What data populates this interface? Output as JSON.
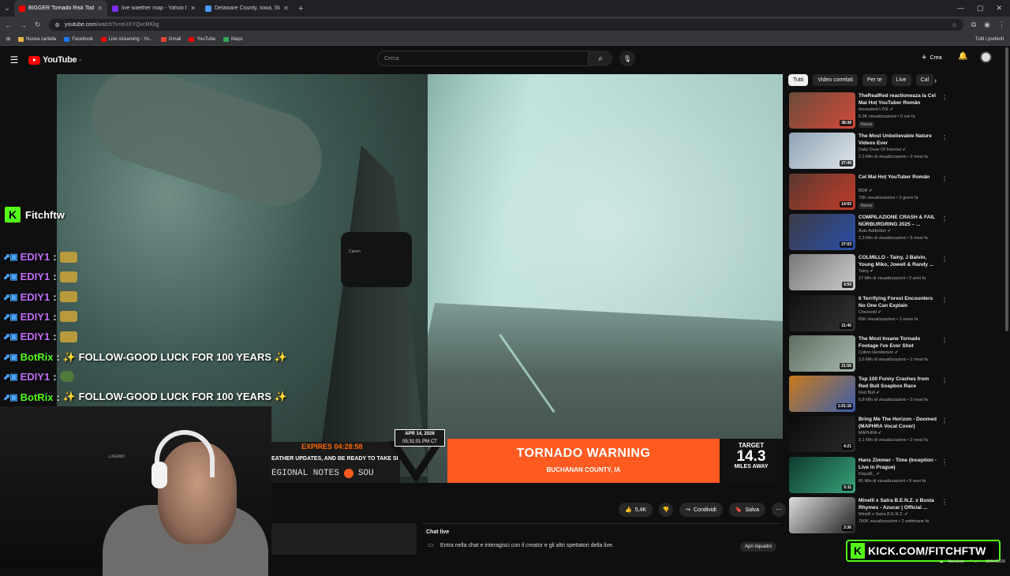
{
  "browser": {
    "tabs": [
      {
        "title": "BIGGER Tornado Risk Today",
        "color": "#ff0000",
        "active": true
      },
      {
        "title": "live waether map - Yahoo Italia",
        "color": "#7b2ff7",
        "active": false
      },
      {
        "title": "Delaware County, Iowa, Stati U...",
        "color": "#4a9bff",
        "active": false
      }
    ],
    "url_host": "youtube.com",
    "url_path": "/watch?v=eUXYQvcRKkg",
    "bookmarks": [
      {
        "label": "Nuova cartella",
        "color": "#e8b64a"
      },
      {
        "label": "Facebook",
        "color": "#1877f2"
      },
      {
        "label": "Live streaming - Yo...",
        "color": "#ff0000"
      },
      {
        "label": "Gmail",
        "color": "#ea4335"
      },
      {
        "label": "YouTube",
        "color": "#ff0000"
      },
      {
        "label": "Maps",
        "color": "#34a853"
      }
    ],
    "bookmarks_right": "Tutti i preferiti"
  },
  "youtube": {
    "logo": "YouTube",
    "logo_sup": "IT",
    "search_placeholder": "Cerca",
    "create_label": "Crea"
  },
  "video": {
    "camera_brand": "Canon",
    "expires": "EXPIRES 04:28:58",
    "updates_text": "EATHER UPDATES, AND BE READY TO TAKE SH",
    "regional_text_a": "EGIONAL NOTES",
    "regional_text_b": "SOU",
    "date": "APR 14, 2026",
    "time": "05:31:01 PM CT",
    "warning_title": "TORNADO WARNING",
    "warning_sub": "BUCHANAN COUNTY, IA",
    "target_label": "TARGET",
    "target_value": "14.3",
    "target_unit": "MILES AWAY",
    "accent": "#ff5a1f"
  },
  "actions": {
    "likes": "5,4K",
    "share": "Condividi",
    "save": "Salva"
  },
  "chat": {
    "title": "Chat live",
    "desc": "Entra nella chat e interagisci con il creator e gli altri spettatori della live.",
    "open": "Apri riquadro"
  },
  "chips": [
    "Tutti",
    "Video correlati",
    "Per te",
    "Live",
    "Cal"
  ],
  "recommendations": [
    {
      "title": "TheRealRed reactioneaza la Cel Mai Hoț YouTuber Român",
      "channel": "therealred LIVE",
      "meta": "6,3K visualizzazioni • 5 ore fa",
      "duration": "38:38",
      "badge": "Nuovo",
      "c1": "#6b4b3a",
      "c2": "#d24a3a"
    },
    {
      "title": "The Most Unbelievable Nature Videos Ever",
      "channel": "Daily Dose Of Internet",
      "meta": "2,3 Mln di visualizzazioni • 2 mesi fa",
      "duration": "27:49",
      "badge": "",
      "c1": "#8fa3b5",
      "c2": "#dfe6ea"
    },
    {
      "title": "Cel Mai Hoț YouTuber Român",
      "channel": "BDR",
      "meta": "73K visualizzazioni • 3 giorni fa",
      "duration": "14:50",
      "badge": "Nuovo",
      "c1": "#5a3a2e",
      "c2": "#c23b2b"
    },
    {
      "title": "COMPILAZIONE CRASH & FAIL NÜRBURGRING 2025 – ...",
      "channel": "Auto Addiction",
      "meta": "2,3 Mln di visualizzazioni • 5 mesi fa",
      "duration": "27:03",
      "badge": "",
      "c1": "#3b3b45",
      "c2": "#2a4fa8"
    },
    {
      "title": "COLMILLO - Tainy, J Balvin, Young Miko, Jowell & Randy ...",
      "channel": "Tainy",
      "meta": "17 Mln di visualizzazioni • 2 anni fa",
      "duration": "4:59",
      "badge": "",
      "c1": "#777",
      "c2": "#ccc"
    },
    {
      "title": "6 Terrifying Forest Encounters No One Can Explain",
      "channel": "Chezzold",
      "meta": "69K visualizzazioni • 1 mese fa",
      "duration": "21:45",
      "badge": "",
      "c1": "#111",
      "c2": "#333"
    },
    {
      "title": "The Most Insane Tornado Footage I've Ever Shot",
      "channel": "Colton Henderson",
      "meta": "3,6 Mln di visualizzazioni • 2 mesi fa",
      "duration": "21:56",
      "badge": "",
      "c1": "#5d6f62",
      "c2": "#a9b7ab"
    },
    {
      "title": "Top 100 Funny Crashes from Red Bull Soapbox Race",
      "channel": "Red Bull",
      "meta": "6,8 Mln di visualizzazioni • 3 mesi fa",
      "duration": "1:01:16",
      "badge": "",
      "c1": "#c97a1c",
      "c2": "#3a5fae"
    },
    {
      "title": "Bring Me The Horizon - Doomed (MAPHRA Vocal Cover)",
      "channel": "MAPHRA",
      "meta": "2,1 Mln di visualizzazioni • 2 mesi fa",
      "duration": "4:21",
      "badge": "",
      "c1": "#0b0b0b",
      "c2": "#2a2a2a"
    },
    {
      "title": "Hans Zimmer - Time (Inception - Live in Prague)",
      "channel": "KlayaR_",
      "meta": "65 Mln di visualizzazioni • 8 anni fa",
      "duration": "5:11",
      "badge": "",
      "c1": "#0e3a2f",
      "c2": "#39a37a"
    },
    {
      "title": "Minelli x Satra B.E.N.Z. x Busta Rhymes - Azucar | Official ...",
      "channel": "Minelli x Satra B.E.N.Z.",
      "meta": "760K visualizzazioni • 2 settimane fa",
      "duration": "3:36",
      "badge": "",
      "c1": "#ddd",
      "c2": "#222"
    }
  ],
  "stream_chat": {
    "streamer": "Fitchftw",
    "messages": [
      {
        "user": "EDIY1",
        "color": "#c46cf7",
        "text": "",
        "emote": "gold"
      },
      {
        "user": "EDIY1",
        "color": "#c46cf7",
        "text": "",
        "emote": "gold"
      },
      {
        "user": "EDIY1",
        "color": "#c46cf7",
        "text": "",
        "emote": "gold"
      },
      {
        "user": "EDIY1",
        "color": "#c46cf7",
        "text": "",
        "emote": "gold"
      },
      {
        "user": "EDIY1",
        "color": "#c46cf7",
        "text": "",
        "emote": "gold"
      },
      {
        "user": "BotRix",
        "color": "#53fc18",
        "text": "✨ FOLLOW-GOOD LUCK FOR 100 YEARS ✨",
        "emote": ""
      },
      {
        "user": "EDIY1",
        "color": "#c46cf7",
        "text": "",
        "emote": "frog"
      },
      {
        "user": "BotRix",
        "color": "#53fc18",
        "text": "✨ FOLLOW-GOOD LUCK FOR 100 YEARS ✨",
        "emote": ""
      }
    ]
  },
  "webcam": {
    "legend_label": "L3GEND"
  },
  "kick_banner": "KICK.COM/FITCHFTW",
  "taskbar": {
    "weather": "Nuvoloso",
    "date": "15/04/2026"
  }
}
